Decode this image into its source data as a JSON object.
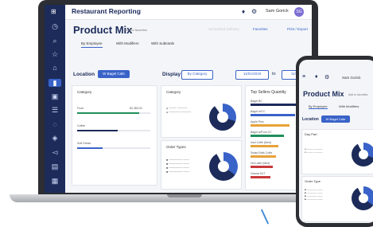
{
  "app": {
    "title": "Restaurant Reporting",
    "user_name": "Sam Gorick",
    "avatar_initials": "SG"
  },
  "page": {
    "title": "Product Mix",
    "add_to_favorites": "Add to favorites",
    "actions": {
      "sched": "Scheduled Delivery",
      "favorites": "Favorites",
      "print": "Print / Export"
    },
    "tabs": [
      "By Employee",
      "With Modifiers",
      "With Subtotals"
    ]
  },
  "filters": {
    "location_label": "Location",
    "location_value": "W Bagel Cafe",
    "display_label": "Display",
    "display_value": "By Category",
    "date_from": "11/01/2019",
    "date_to_label": "to",
    "date_to": "11/01/"
  },
  "cards": {
    "left_title": "Category",
    "left_rows": [
      {
        "label": "Food",
        "value": "$2,380.00",
        "color": "#1f8f5b",
        "pct": 0.85
      },
      {
        "label": "Coffee",
        "value": "",
        "color": "#1c2b5a",
        "pct": 0.55
      },
      {
        "label": "Soft Drinks",
        "value": "",
        "color": "#3a63c9",
        "pct": 0.35
      }
    ],
    "middle_top_title": "Category",
    "middle_bottom_title": "Order Types",
    "right_title": "Top Sellers Quantity",
    "top_sellers": [
      {
        "label": "Bagel BC",
        "color": "#1c2b5a",
        "pct": 0.95
      },
      {
        "label": "Bagel w/CC",
        "color": "#3a63c9",
        "pct": 0.8
      },
      {
        "label": "Apple Pies",
        "color": "#e8a23a",
        "pct": 0.7
      },
      {
        "label": "Bagel w/Pum CC",
        "color": "#1f8f5b",
        "pct": 0.6
      },
      {
        "label": "Iced Coffe (Med)",
        "color": "#e8a23a",
        "pct": 0.5
      },
      {
        "label": "Swiss Rolls Coffe",
        "color": "#e8a23a",
        "pct": 0.45
      },
      {
        "label": "Hot Latte (Med)",
        "color": "#c93a3a",
        "pct": 0.4
      },
      {
        "label": "Classic BLT",
        "color": "#c93a3a",
        "pct": 0.35
      }
    ]
  },
  "phone": {
    "title": "Product Mix",
    "add_to_favorites": "Add to favorites",
    "tabs": [
      "By Employee",
      "With Modifiers"
    ],
    "location_label": "Location",
    "location_value": "W Bagel Cafe",
    "card1_title": "Day Part",
    "card2_title": "Order Type"
  },
  "icons": {
    "menu": "grid-icon",
    "bell": "bell-icon",
    "gear": "gear-icon"
  },
  "colors": {
    "sidebar": "#1c2b5a",
    "accent": "#3a63c9",
    "chart_dark": "#1c2b5a",
    "chart_blue": "#3a63c9",
    "chart_white": "#ffffff"
  }
}
